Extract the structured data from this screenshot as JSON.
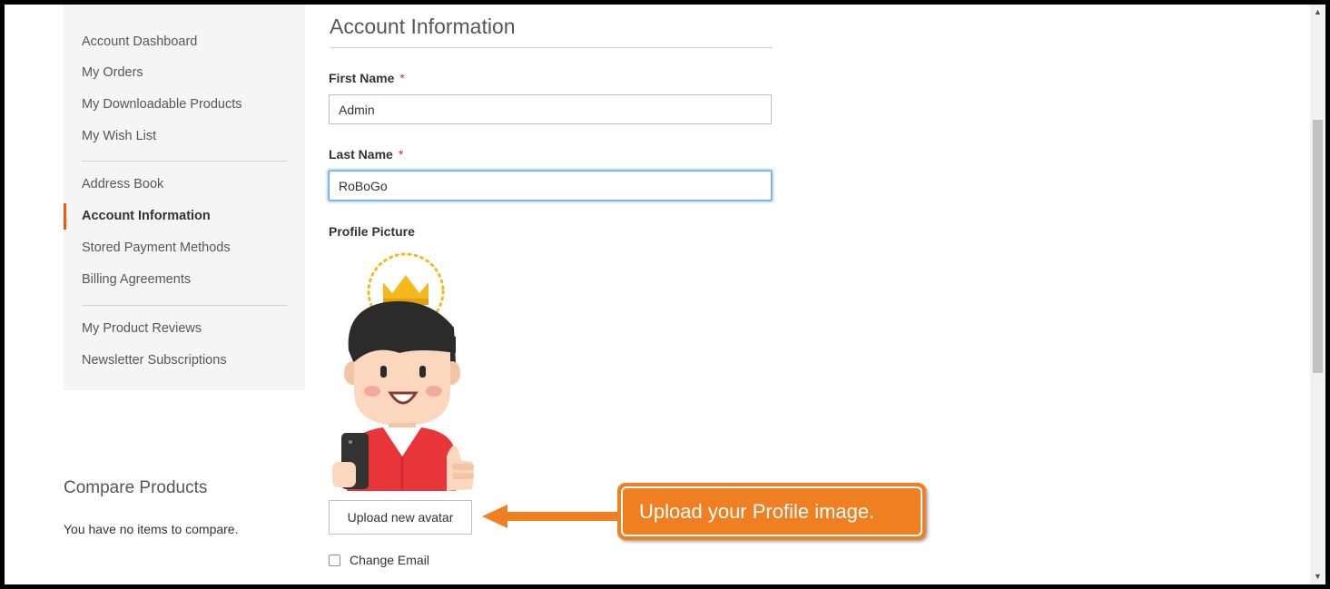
{
  "sidebar": {
    "items": [
      {
        "label": "Account Dashboard"
      },
      {
        "label": "My Orders"
      },
      {
        "label": "My Downloadable Products"
      },
      {
        "label": "My Wish List"
      },
      {
        "label": "Address Book"
      },
      {
        "label": "Account Information"
      },
      {
        "label": "Stored Payment Methods"
      },
      {
        "label": "Billing Agreements"
      },
      {
        "label": "My Product Reviews"
      },
      {
        "label": "Newsletter Subscriptions"
      }
    ],
    "active_item": "Account Information",
    "accent_color": "#ff5501"
  },
  "compare": {
    "title": "Compare Products",
    "empty_text": "You have no items to compare."
  },
  "main": {
    "title": "Account Information",
    "first_name": {
      "label": "First Name",
      "required_mark": "*",
      "value": "Admin"
    },
    "last_name": {
      "label": "Last Name",
      "required_mark": "*",
      "value": "RoBoGo"
    },
    "profile_picture": {
      "label": "Profile Picture",
      "image": "avatar-king-thumbs-up"
    },
    "upload_button": "Upload new avatar",
    "change_email": {
      "label": "Change Email",
      "checked": false
    }
  },
  "callout": {
    "text": "Upload your Profile image.",
    "color": "#f07f22"
  },
  "scrollbar": {
    "up_icon": "▲",
    "down_icon": "▼"
  }
}
